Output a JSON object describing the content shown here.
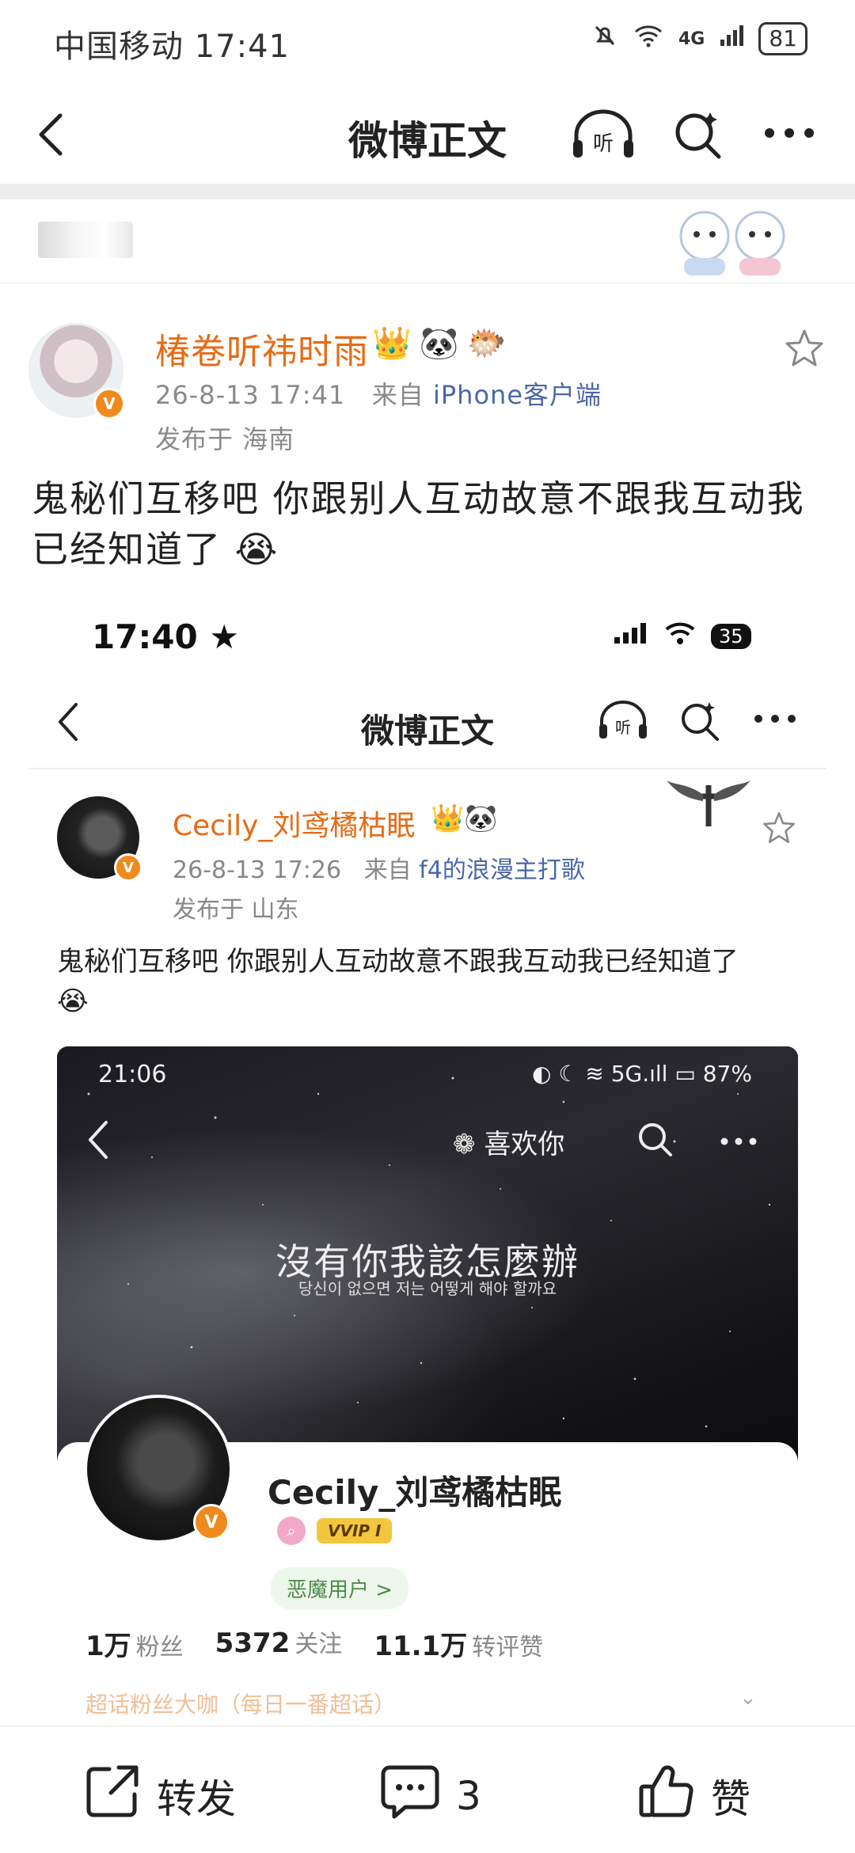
{
  "status_bar": {
    "carrier_time": "中国移动 17:41",
    "network": "4G",
    "battery": "81"
  },
  "nav": {
    "title": "微博正文"
  },
  "post": {
    "username": "椿卷听祎时雨",
    "emojis": [
      "👑",
      "🐼",
      "🐡"
    ],
    "date": "26-8-13 17:41",
    "source_prefix": "来自",
    "source": "iPhone客户端",
    "location": "发布于 海南",
    "text": "鬼秘们互移吧 你跟别人互动故意不跟我互动我已经知道了 😭"
  },
  "embedded": {
    "time": "17:40 ★",
    "battery": "35",
    "nav_title": "微博正文",
    "username": "Cecily_刘鸢橘枯眠",
    "emojis": "👑🐼",
    "date": "26-8-13 17:26",
    "source_prefix": "来自",
    "source": "f4的浪漫主打歌",
    "location": "发布于 山东",
    "text": "鬼秘们互移吧 你跟别人互动故意不跟我互动我已经知道了",
    "text_emoji": "😭",
    "inner": {
      "time": "21:06",
      "status_text": "◐ ☾ ≋ 5G.ıll ▭ 87%",
      "like_tag": "喜欢你",
      "main_text": "沒有你我該怎麼辦",
      "sub_text": "당신이 없으면 저는 어떻게 해야 할까요",
      "username": "Cecily_刘鸢橘枯眠",
      "vvip": "VVIP I",
      "devil_tag": "恶魔用户 >",
      "stats": [
        {
          "value": "1万",
          "label": "粉丝"
        },
        {
          "value": "5372",
          "label": "关注"
        },
        {
          "value": "11.1万",
          "label": "转评赞"
        }
      ],
      "strip_text": "超话粉丝大咖（每日一番超话）"
    }
  },
  "actions": {
    "repost": "转发",
    "comment_count": "3",
    "like": "赞"
  }
}
